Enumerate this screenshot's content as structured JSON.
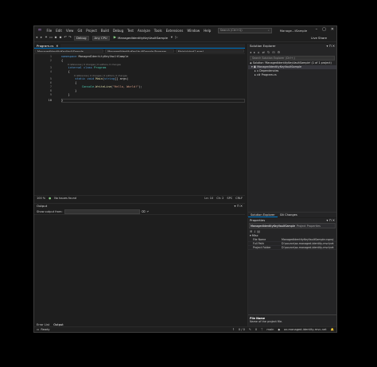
{
  "menubar": {
    "items": [
      "File",
      "Edit",
      "View",
      "Git",
      "Project",
      "Build",
      "Debug",
      "Test",
      "Analyze",
      "Tools",
      "Extensions",
      "Window",
      "Help"
    ],
    "search_placeholder": "Search (Ctrl+Q)",
    "window_title": "Manage...tSample"
  },
  "toolbar": {
    "config": "Debug",
    "platform": "Any CPU",
    "run_target": "ManagedIdentityKeyVaultSample",
    "live_share": "Live Share"
  },
  "editor": {
    "tab_label": "Program.cs",
    "nav": [
      "ManagedIdentityKeyVaultSample",
      "ManagedIdentityKeyVaultSample.Program",
      "Main(string[] args)"
    ],
    "line_numbers": [
      "1",
      "2",
      "3",
      "4",
      "5",
      "6",
      "7",
      "8",
      "9",
      "10"
    ],
    "codelens_class": "0 references | 0 changes | 0 authors, 0 changes",
    "codelens_method": "0 references | 0 changes | 0 authors, 0 changes",
    "status": {
      "zoom": "100 %",
      "issues": "No issues found",
      "ln": "Ln: 10",
      "ch": "Ch: 2",
      "spc": "SPC",
      "crlf": "CRLF"
    }
  },
  "solution_explorer": {
    "title": "Solution Explorer",
    "search_placeholder": "Search Solution Explorer (Ctrl+;)",
    "solution": "Solution 'ManagedIdentityKeyVaultSample' (1 of 1 project)",
    "project": "ManagedIdentityKeyVaultSample",
    "dependencies": "Dependencies",
    "file": "Program.cs",
    "tabs": [
      "Solution Explorer",
      "Git Changes"
    ]
  },
  "output": {
    "title": "Output",
    "show_from": "Show output from:",
    "tabs": [
      "Error List",
      "Output"
    ]
  },
  "properties": {
    "title": "Properties",
    "selected_object": "ManagedIdentityKeyVaultSample",
    "selected_type": "Project Properties",
    "category": "Misc",
    "rows": [
      {
        "key": "File Name",
        "value": "ManagedIdentityKeyVaultSample.csproj"
      },
      {
        "key": "Full Path",
        "value": "D:\\source\\az-managed-identity-mvc\\net"
      },
      {
        "key": "Project Folder",
        "value": "D:\\source\\az-managed-identity-mvc\\net"
      }
    ],
    "desc_title": "File Name",
    "desc_text": "Name of the project file."
  },
  "statusbar": {
    "ready": "Ready",
    "errors": "0 / 0",
    "changes": "0",
    "branch": "main",
    "repo": "az-managed-identity-mvc-net"
  }
}
